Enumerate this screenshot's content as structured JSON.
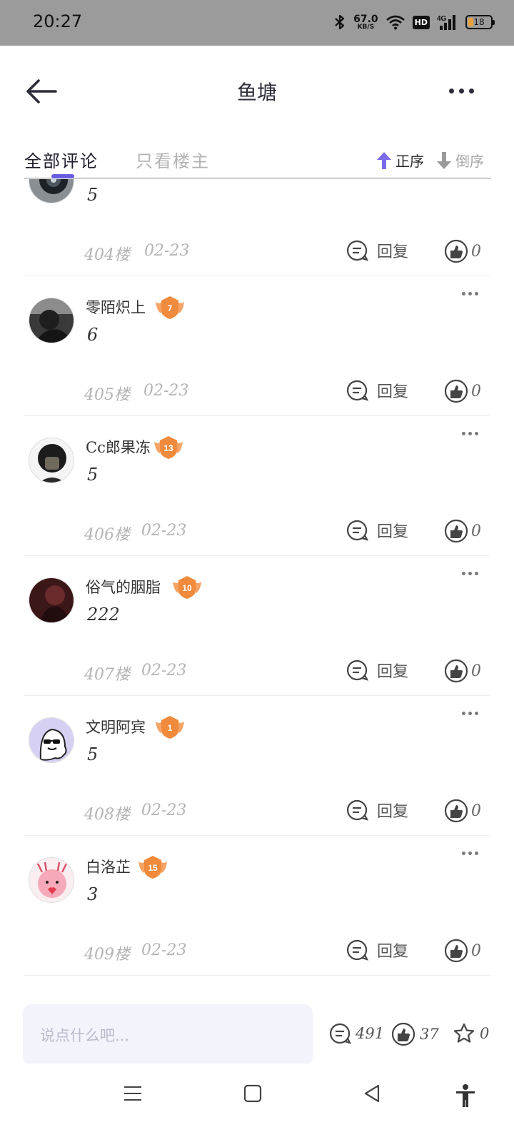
{
  "status_bar": {
    "time": "20:27",
    "net_speed": "67.0",
    "net_unit": "KB/S",
    "hd": "HD",
    "signal": "4G",
    "battery": "18"
  },
  "header": {
    "title": "鱼塘"
  },
  "tabs": {
    "all": "全部评论",
    "owner_only": "只看楼主",
    "sort_asc": "正序",
    "sort_desc": "倒序"
  },
  "comments": [
    {
      "username": "",
      "level": "",
      "content": "5",
      "floor": "404楼",
      "date": "02-23",
      "reply_label": "回复",
      "likes": "0",
      "avatar": "dark-lens"
    },
    {
      "username": "零陌炽上",
      "level": "7",
      "content": "6",
      "floor": "405楼",
      "date": "02-23",
      "reply_label": "回复",
      "likes": "0",
      "avatar": "dark-photo"
    },
    {
      "username": "Cc郎果冻",
      "level": "13",
      "content": "5",
      "floor": "406楼",
      "date": "02-23",
      "reply_label": "回复",
      "likes": "0",
      "avatar": "masked-person"
    },
    {
      "username": "俗气的胭脂",
      "level": "10",
      "content": "222",
      "floor": "407楼",
      "date": "02-23",
      "reply_label": "回复",
      "likes": "0",
      "avatar": "red-dark"
    },
    {
      "username": "文明阿宾",
      "level": "1",
      "content": "5",
      "floor": "408楼",
      "date": "02-23",
      "reply_label": "回复",
      "likes": "0",
      "avatar": "ghost-sunglasses"
    },
    {
      "username": "白洛芷",
      "level": "15",
      "content": "3",
      "floor": "409楼",
      "date": "02-23",
      "reply_label": "回复",
      "likes": "0",
      "avatar": "pink-cartoon"
    }
  ],
  "bottom_bar": {
    "input_placeholder": "说点什么吧...",
    "comment_count": "491",
    "like_count": "37",
    "favorite_count": "0"
  },
  "colors": {
    "accent": "#6a5ce0",
    "badge": "#f08a3c",
    "status_bar": "#9b9b9b"
  }
}
